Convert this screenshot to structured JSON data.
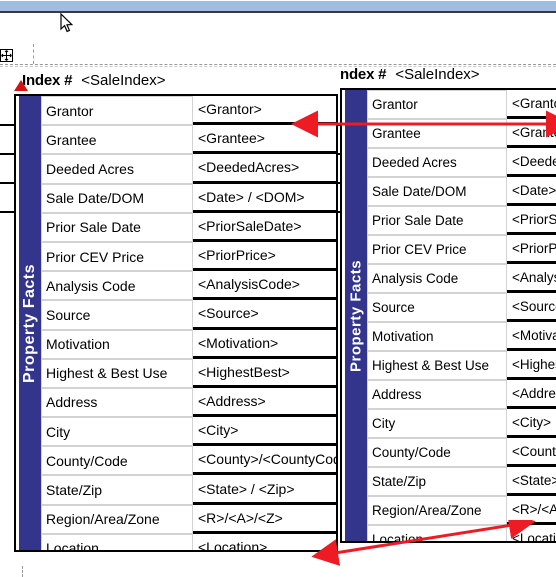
{
  "window": {
    "titlebar_color": "#9fbce1",
    "accent_color": "#33348c",
    "annotation_color": "#ed1c24"
  },
  "toolbar": {
    "move_handle_label": "move-handle",
    "cursor_label": "mouse-pointer"
  },
  "blocks": [
    {
      "id": "left",
      "header": {
        "index_label": "Index #",
        "index_value": "<SaleIndex>",
        "marker": "red-triangle"
      },
      "spine_label": "Property Facts",
      "rows": [
        {
          "label": "Grantor",
          "value": "<Grantor>"
        },
        {
          "label": "Grantee",
          "value": "<Grantee>"
        },
        {
          "label": "Deeded Acres",
          "value": "<DeededAcres>"
        },
        {
          "label": "Sale Date/DOM",
          "value": "<Date>  /  <DOM>"
        },
        {
          "label": "Prior Sale Date",
          "value": "<PriorSaleDate>"
        },
        {
          "label": "Prior CEV Price",
          "value": "<PriorPrice>"
        },
        {
          "label": "Analysis Code",
          "value": "<AnalysisCode>"
        },
        {
          "label": "Source",
          "value": "<Source>"
        },
        {
          "label": "Motivation",
          "value": "<Motivation>"
        },
        {
          "label": "Highest & Best Use",
          "value": "<HighestBest>"
        },
        {
          "label": "Address",
          "value": "<Address>"
        },
        {
          "label": "City",
          "value": "<City>"
        },
        {
          "label": "County/Code",
          "value": "<County>/<CountyCode>"
        },
        {
          "label": "State/Zip",
          "value": "<State> / <Zip>"
        },
        {
          "label": "Region/Area/Zone",
          "value": "<R>/<A>/<Z>"
        },
        {
          "label": "Location",
          "value": "<Location>"
        }
      ]
    },
    {
      "id": "right",
      "header": {
        "index_label": "ndex #",
        "index_value": "<SaleIndex>",
        "marker": "none"
      },
      "spine_label": "Property Facts",
      "rows": [
        {
          "label": "Grantor",
          "value": "<Grantor>"
        },
        {
          "label": "Grantee",
          "value": "<Grantee>"
        },
        {
          "label": "Deeded Acres",
          "value": "<Deeded"
        },
        {
          "label": "Sale Date/DOM",
          "value": "<Date> /"
        },
        {
          "label": "Prior Sale Date",
          "value": "<PriorSa"
        },
        {
          "label": "Prior CEV Price",
          "value": "<PriorPri"
        },
        {
          "label": "Analysis Code",
          "value": "<Analysis"
        },
        {
          "label": "Source",
          "value": "<Source>"
        },
        {
          "label": "Motivation",
          "value": "<Motivati"
        },
        {
          "label": "Highest & Best Use",
          "value": "<Highest"
        },
        {
          "label": "Address",
          "value": "<Address"
        },
        {
          "label": "City",
          "value": "<City>"
        },
        {
          "label": "County/Code",
          "value": "<County>"
        },
        {
          "label": "State/Zip",
          "value": "<State>/<"
        },
        {
          "label": "Region/Area/Zone",
          "value": "<R>/<A>"
        },
        {
          "label": "Location",
          "value": "<Location"
        }
      ]
    }
  ],
  "annotations": [
    {
      "name": "width-compare-arrow",
      "style": "double-headed-horizontal"
    },
    {
      "name": "height-compare-arrow",
      "style": "double-headed-diagonal"
    }
  ]
}
